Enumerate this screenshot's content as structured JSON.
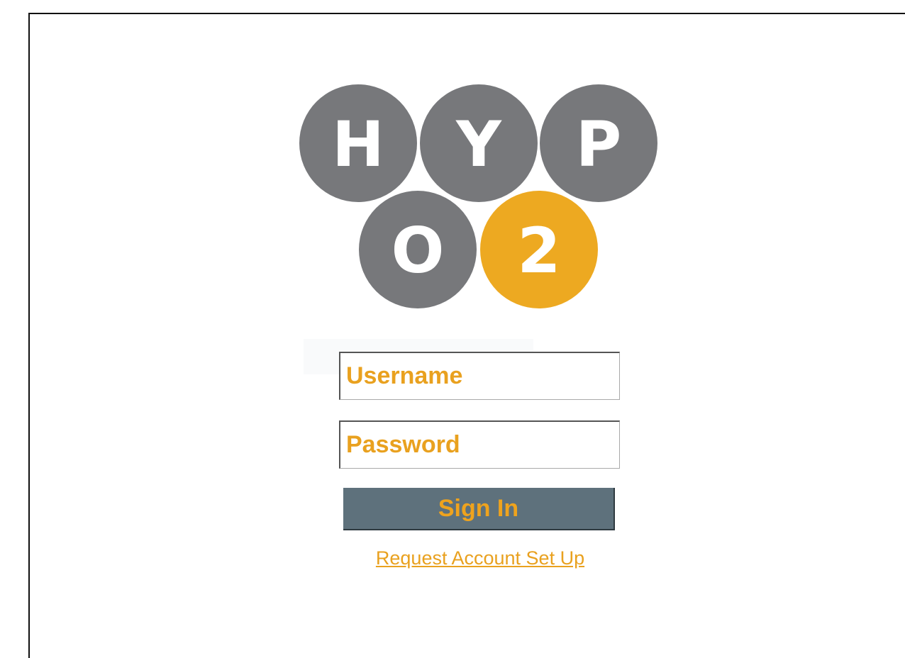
{
  "logo": {
    "letters": [
      "H",
      "Y",
      "P",
      "O",
      "2"
    ],
    "colors": {
      "circle": "#77787b",
      "accent": "#eda921",
      "letter": "#ffffff"
    }
  },
  "login": {
    "username_placeholder": "Username",
    "password_placeholder": "Password",
    "sign_in_label": "Sign In",
    "request_account_label": "Request Account Set Up"
  },
  "colors": {
    "field_text": "#e9a11f",
    "button_bg": "#5e717c",
    "button_text": "#efa31d",
    "link": "#e9a11f"
  }
}
